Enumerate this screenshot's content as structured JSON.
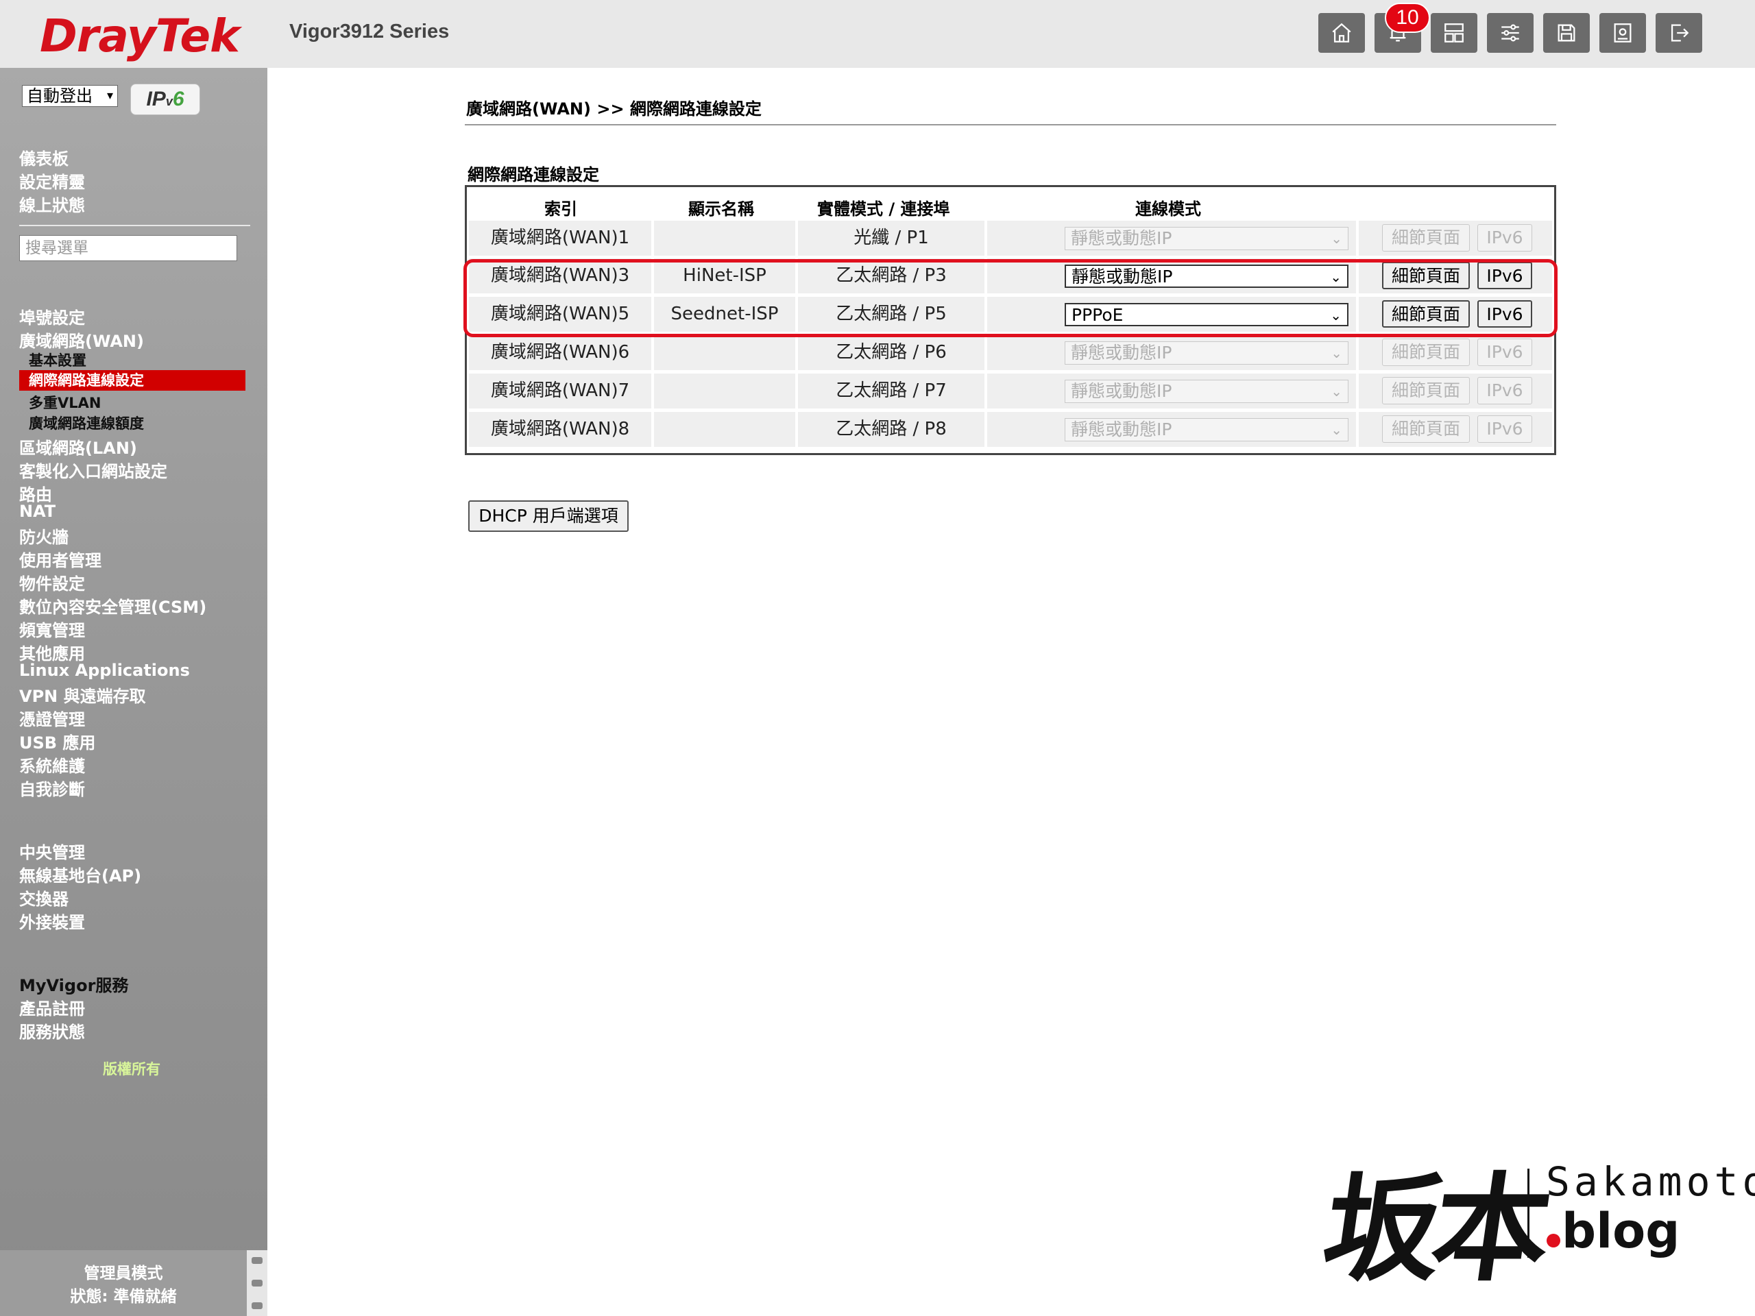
{
  "header": {
    "logo": "DrayTek",
    "model": "Vigor3912 Series",
    "notification_count": "10",
    "toolbar_icons": [
      "home-icon",
      "bell-icon",
      "dashboard-layout-icon",
      "sliders-icon",
      "save-icon",
      "config-backup-icon",
      "logout-icon"
    ]
  },
  "sidebar": {
    "logout_select": "自動登出",
    "ipv6_logo": {
      "ip": "IP",
      "v": "v",
      "six": "6"
    },
    "top_links": [
      "儀表板",
      "設定精靈",
      "線上狀態"
    ],
    "search_placeholder": "搜尋選單",
    "menu": [
      "埠號設定",
      "廣域網路(WAN)"
    ],
    "wan_sub": [
      "基本設置",
      "網際網路連線設定",
      "多重VLAN",
      "廣域網路連線額度"
    ],
    "menu2": [
      "區域網路(LAN)",
      "客製化入口網站設定",
      "路由",
      "NAT",
      "防火牆",
      "使用者管理",
      "物件設定",
      "數位內容安全管理(CSM)",
      "頻寬管理",
      "其他應用",
      "Linux Applications",
      "VPN 與遠端存取",
      "憑證管理",
      "USB 應用",
      "系統維護",
      "自我診斷"
    ],
    "menu3": [
      "中央管理",
      "無線基地台(AP)",
      "交換器",
      "外接裝置"
    ],
    "menu4": [
      "MyVigor服務",
      "產品註冊",
      "服務狀態"
    ],
    "copyright": "版權所有",
    "status": {
      "mode": "管理員模式",
      "state": "狀態: 準備就緒"
    }
  },
  "main": {
    "breadcrumb": "廣域網路(WAN) >> 網際網路連線設定",
    "section_title": "網際網路連線設定",
    "columns": [
      "索引",
      "顯示名稱",
      "實體模式 / 連接埠",
      "連線模式"
    ],
    "rows": [
      {
        "index": "廣域網路(WAN)1",
        "name": "",
        "physical": "光纖 / P1",
        "mode": "靜態或動態IP",
        "enabled": false
      },
      {
        "index": "廣域網路(WAN)3",
        "name": "HiNet-ISP",
        "physical": "乙太網路 / P3",
        "mode": "靜態或動態IP",
        "enabled": true
      },
      {
        "index": "廣域網路(WAN)5",
        "name": "Seednet-ISP",
        "physical": "乙太網路 / P5",
        "mode": "PPPoE",
        "enabled": true
      },
      {
        "index": "廣域網路(WAN)6",
        "name": "",
        "physical": "乙太網路 / P6",
        "mode": "靜態或動態IP",
        "enabled": false
      },
      {
        "index": "廣域網路(WAN)7",
        "name": "",
        "physical": "乙太網路 / P7",
        "mode": "靜態或動態IP",
        "enabled": false
      },
      {
        "index": "廣域網路(WAN)8",
        "name": "",
        "physical": "乙太網路 / P8",
        "mode": "靜態或動態IP",
        "enabled": false
      }
    ],
    "detail_label": "細節頁面",
    "ipv6_label": "IPv6",
    "dhcp_button": "DHCP 用戶端選項"
  },
  "watermark": {
    "cjk": "坂本",
    "sakamoto": "Sakamoto",
    "blog": "blog"
  },
  "colors": {
    "brand_red": "#d5111c",
    "highlight": "#e0101e",
    "active_menu": "#d10000"
  }
}
